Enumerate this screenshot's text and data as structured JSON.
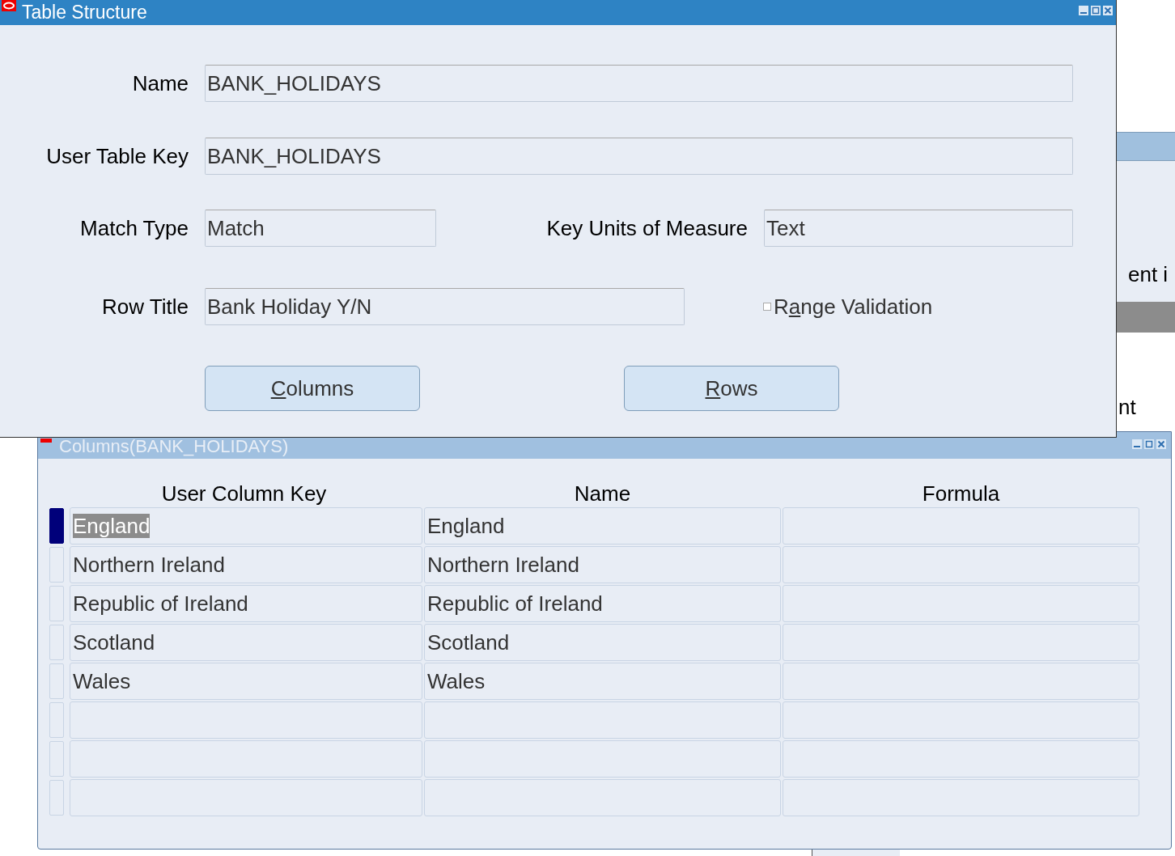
{
  "background_window": {
    "texts": [
      "ent i",
      "nt"
    ]
  },
  "window": {
    "title": "Table Structure",
    "name": {
      "label": "Name",
      "value": "BANK_HOLIDAYS"
    },
    "user_table_key": {
      "label": "User Table Key",
      "value": "BANK_HOLIDAYS"
    },
    "match_type": {
      "label": "Match Type",
      "value": "Match"
    },
    "key_units_of_measure": {
      "label": "Key Units of Measure",
      "value": "Text"
    },
    "row_title": {
      "label": "Row Title",
      "value": "Bank Holiday Y/N"
    },
    "range_validation": {
      "before": "R",
      "mnemonic": "a",
      "after": "nge Validation",
      "checked": false
    },
    "buttons": [
      {
        "mnemonic": "C",
        "after": "olumns"
      },
      {
        "mnemonic": "R",
        "after": "ows"
      }
    ]
  },
  "columns_window": {
    "title": "Columns(BANK_HOLIDAYS)",
    "active": false,
    "columns": [
      "User Column Key",
      "Name",
      "Formula"
    ],
    "rows": [
      {
        "cells": [
          "England",
          "England"
        ],
        "selected": true
      },
      {
        "cells": [
          "Northern Ireland",
          "Northern Ireland"
        ],
        "selected": false
      },
      {
        "cells": [
          "Republic of Ireland",
          "Republic of Ireland"
        ],
        "selected": false
      },
      {
        "cells": [
          "Scotland",
          "Scotland"
        ],
        "selected": false
      },
      {
        "cells": [
          "Wales",
          "Wales"
        ],
        "selected": false
      },
      {
        "selected": false
      },
      {
        "selected": false
      },
      {
        "selected": false
      }
    ]
  }
}
